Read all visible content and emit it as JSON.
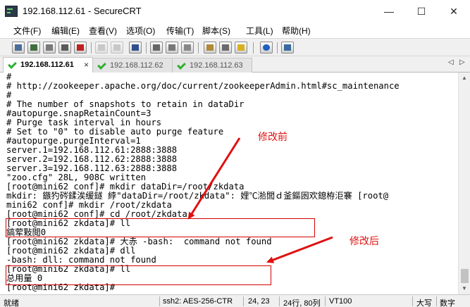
{
  "window": {
    "title": "192.168.112.61 - SecureCRT",
    "minimize": "—",
    "maximize": "☐",
    "close": "✕"
  },
  "menu": [
    "文件(F)",
    "编辑(E)",
    "查看(V)",
    "选项(O)",
    "传输(T)",
    "脚本(S)",
    "工具(L)",
    "帮助(H)"
  ],
  "tabs": [
    {
      "label": "192.168.112.61",
      "active": true,
      "close": "×"
    },
    {
      "label": "192.168.112.62",
      "active": false
    },
    {
      "label": "192.168.112.63",
      "active": false
    }
  ],
  "tab_nav": {
    "prev": "◁",
    "next": "▷"
  },
  "terminal": {
    "lines": [
      "#",
      "# http://zookeeper.apache.org/doc/current/zookeeperAdmin.html#sc_maintenance",
      "#",
      "# The number of snapshots to retain in dataDir",
      "#autopurge.snapRetainCount=3",
      "# Purge task interval in hours",
      "# Set to \"0\" to disable auto purge feature",
      "#autopurge.purgeInterval=1",
      "server.1=192.168.112.61:2888:3888",
      "server.2=192.168.112.62:2888:3888",
      "server.3=192.168.112.63:2888:3888",
      "\"zoo.cfg\" 28L, 908C written",
      "[root@mini62 conf]# mkdir dataDir=/root/zkdata",
      "mkdir: 鏃犳硶鍒涘缓鐩 綍\"dataDir=/root/zkdata\": 娌℃湁閭ｄ釜鏂囦欢鎴栫洰褰 [root@",
      "mini62 conf]# mkdir /root/zkdata",
      "[root@mini62 conf]# cd /root/zkdata",
      "[root@mini62 zkdata]# ll",
      "鎬荤敤閲0",
      "[root@mini62 zkdata]# 大赤 -bash:  command not found",
      "[root@mini62 zkdata]# dll",
      "-bash: dll: command not found",
      "[root@mini62 zkdata]# ll",
      "总用量 0",
      "[root@mini62 zkdata]#"
    ]
  },
  "annotations": {
    "before": "修改前",
    "after": "修改后"
  },
  "status": {
    "ready": "就绪",
    "cipher": "ssh2: AES-256-CTR",
    "cursor": "24, 23",
    "size": "24行, 80列",
    "term": "VT100",
    "caps": "大写",
    "num": "数字"
  },
  "colors": {
    "accent_red": "#d40000",
    "tab_check": "#2fb02f"
  }
}
